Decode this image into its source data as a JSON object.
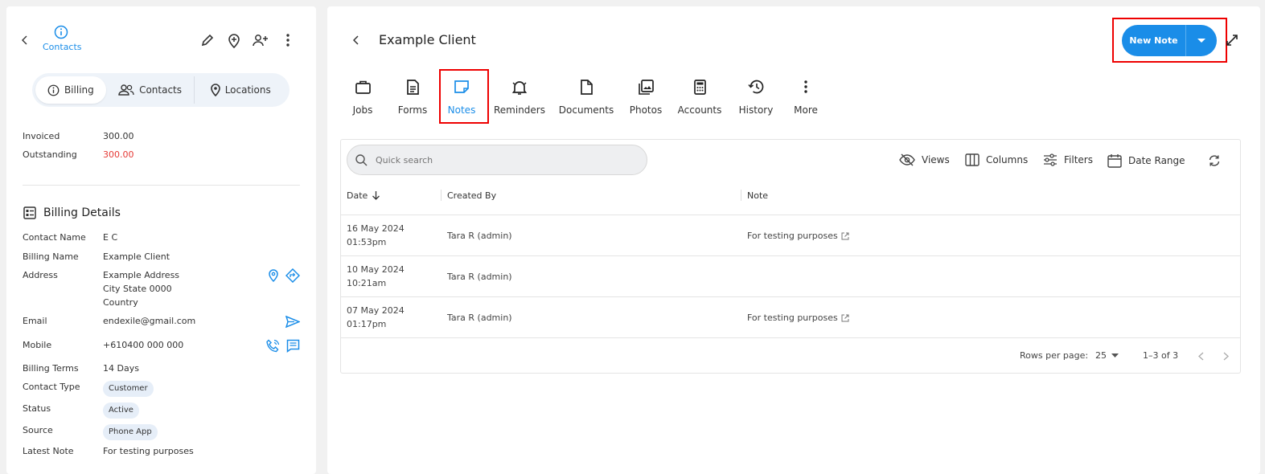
{
  "left": {
    "back_icon": "chevron-left",
    "contacts_label": "Contacts",
    "segments": [
      {
        "label": "Billing",
        "icon": "info-icon",
        "active": true
      },
      {
        "label": "Contacts",
        "icon": "people-icon",
        "active": false
      },
      {
        "label": "Locations",
        "icon": "location-icon",
        "active": false
      }
    ],
    "invoiced_label": "Invoiced",
    "invoiced_value": "300.00",
    "outstanding_label": "Outstanding",
    "outstanding_value": "300.00",
    "billing_details_title": "Billing Details",
    "fields": {
      "contact_name_label": "Contact Name",
      "contact_name": "E C",
      "billing_name_label": "Billing Name",
      "billing_name": "Example Client",
      "address_label": "Address",
      "address_line1": "Example Address",
      "address_line2": "City State 0000",
      "address_line3": "Country",
      "email_label": "Email",
      "email": "endexile@gmail.com",
      "mobile_label": "Mobile",
      "mobile": "+610400 000 000",
      "billing_terms_label": "Billing Terms",
      "billing_terms": "14 Days",
      "contact_type_label": "Contact Type",
      "contact_type": "Customer",
      "status_label": "Status",
      "status": "Active",
      "source_label": "Source",
      "source": "Phone App",
      "latest_note_label": "Latest Note",
      "latest_note": "For testing purposes"
    },
    "colors": {
      "accent": "#1a8de8",
      "danger": "#e53935"
    }
  },
  "main": {
    "title": "Example Client",
    "new_note_label": "New Note",
    "tabs": [
      {
        "label": "Jobs"
      },
      {
        "label": "Forms"
      },
      {
        "label": "Notes"
      },
      {
        "label": "Reminders"
      },
      {
        "label": "Documents"
      },
      {
        "label": "Photos"
      },
      {
        "label": "Accounts"
      },
      {
        "label": "History"
      },
      {
        "label": "More"
      }
    ],
    "search_placeholder": "Quick search",
    "toolbar": {
      "views": "Views",
      "columns": "Columns",
      "filters": "Filters",
      "date_range": "Date Range"
    },
    "columns": {
      "date": "Date",
      "created_by": "Created By",
      "note": "Note"
    },
    "rows": [
      {
        "date": "16 May 2024",
        "time": "01:53pm",
        "created_by": "Tara R (admin)",
        "note": "For testing purposes"
      },
      {
        "date": "10 May 2024",
        "time": "10:21am",
        "created_by": "Tara R (admin)",
        "note": ""
      },
      {
        "date": "07 May 2024",
        "time": "01:17pm",
        "created_by": "Tara R (admin)",
        "note": "For testing purposes"
      }
    ],
    "footer": {
      "rows_per_page_label": "Rows per page:",
      "rows_per_page": "25",
      "range": "1–3 of 3"
    }
  }
}
